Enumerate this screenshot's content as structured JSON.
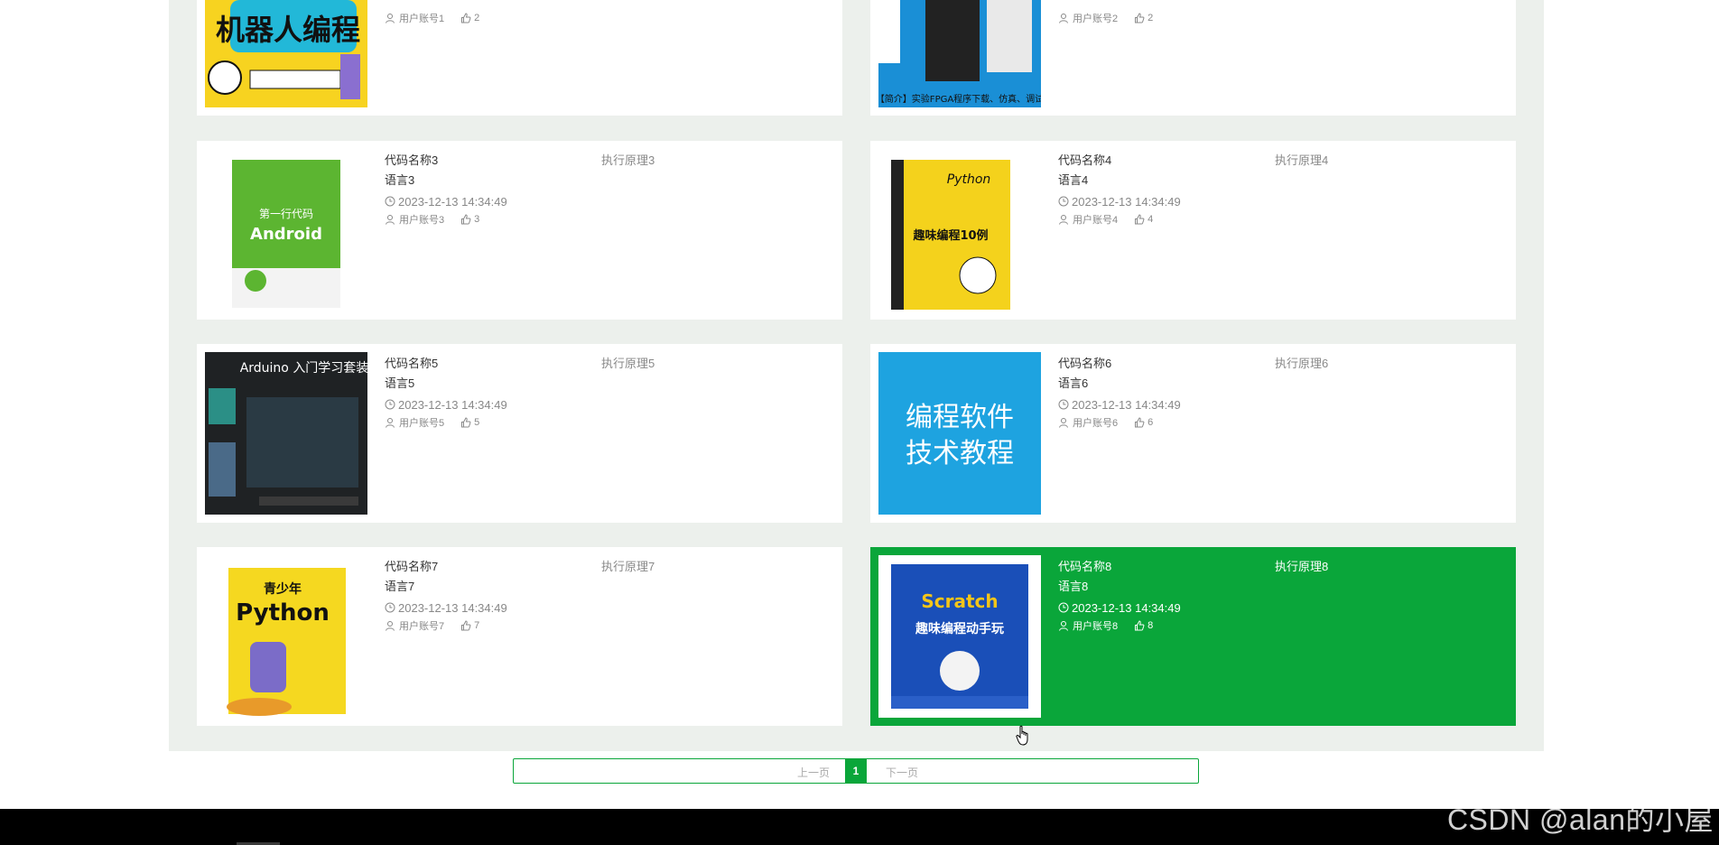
{
  "colors": {
    "accent": "#0aa63a",
    "panel": "#ecf0ec"
  },
  "top_cards": [
    {
      "account": "用户账号1",
      "likes": "2",
      "cover": "机器人编程"
    },
    {
      "account": "用户账号2",
      "likes": "2",
      "cover": "【简介】实验FPGA程序下载、仿真、调试"
    }
  ],
  "cards": [
    {
      "name": "代码名称3",
      "principle": "执行原理3",
      "language": "语言3",
      "date": "2023-12-13 14:34:49",
      "account": "用户账号3",
      "likes": "3",
      "cover_title": "第一行代码",
      "cover_sub": "Android",
      "active": false
    },
    {
      "name": "代码名称4",
      "principle": "执行原理4",
      "language": "语言4",
      "date": "2023-12-13 14:34:49",
      "account": "用户账号4",
      "likes": "4",
      "cover_title": "Python",
      "cover_sub": "趣味编程10例",
      "active": false
    },
    {
      "name": "代码名称5",
      "principle": "执行原理5",
      "language": "语言5",
      "date": "2023-12-13 14:34:49",
      "account": "用户账号5",
      "likes": "5",
      "cover_title": "Arduino 入门学习套装",
      "cover_sub": "",
      "active": false
    },
    {
      "name": "代码名称6",
      "principle": "执行原理6",
      "language": "语言6",
      "date": "2023-12-13 14:34:49",
      "account": "用户账号6",
      "likes": "6",
      "cover_title": "编程软件",
      "cover_sub": "技术教程",
      "active": false
    },
    {
      "name": "代码名称7",
      "principle": "执行原理7",
      "language": "语言7",
      "date": "2023-12-13 14:34:49",
      "account": "用户账号7",
      "likes": "7",
      "cover_title": "青少年",
      "cover_sub": "Python",
      "active": false
    },
    {
      "name": "代码名称8",
      "principle": "执行原理8",
      "language": "语言8",
      "date": "2023-12-13 14:34:49",
      "account": "用户账号8",
      "likes": "8",
      "cover_title": "Scratch",
      "cover_sub": "趣味编程动手玩",
      "active": true
    }
  ],
  "pagination": {
    "prev": "上一页",
    "current": "1",
    "next": "下一页"
  },
  "watermark": "CSDN @alan的小屋"
}
